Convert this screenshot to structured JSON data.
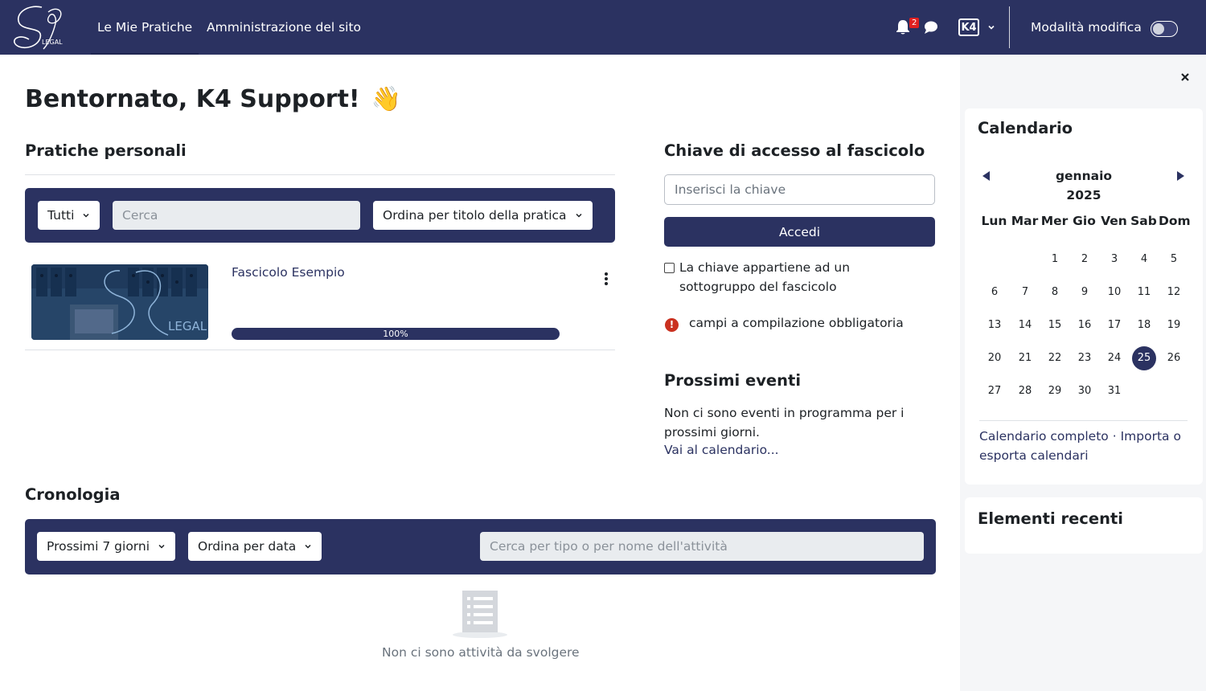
{
  "navbar": {
    "logo_text": "LEGAL",
    "links": [
      "Le Mie Pratiche",
      "Amministrazione del sito"
    ],
    "notification_count": "2",
    "user_initials": "K4",
    "edit_mode_label": "Modalità modifica",
    "bg_color": "#2b3261"
  },
  "main": {
    "greeting": "Bentornato, K4 Support!",
    "greeting_emoji": "👋",
    "personal": {
      "title": "Pratiche personali",
      "filter_label": "Tutti",
      "search_placeholder": "Cerca",
      "sort_label": "Ordina per titolo della pratica",
      "course": {
        "title": "Fascicolo Esempio",
        "image_text": "LEGAL",
        "progress_label": "100%",
        "progress_fraction": 1.0
      }
    },
    "access_key": {
      "title": "Chiave di accesso al fascicolo",
      "placeholder": "Inserisci la chiave",
      "button": "Accedi",
      "checkbox_label": "La chiave appartiene ad un sottogruppo del fascicolo",
      "required_note": "campi a compilazione obbligatoria"
    },
    "events": {
      "title": "Prossimi eventi",
      "empty_text": "Non ci sono eventi in programma per i prossimi giorni.",
      "link": "Vai al calendario..."
    },
    "timeline": {
      "title": "Cronologia",
      "range_label": "Prossimi 7 giorni",
      "sort_label": "Ordina per data",
      "search_placeholder": "Cerca per tipo o per nome dell'attività",
      "empty_text": "Non ci sono attività da svolgere"
    }
  },
  "drawer": {
    "calendar": {
      "title": "Calendario",
      "month": "gennaio",
      "year": "2025",
      "weekdays": [
        "Lun",
        "Mar",
        "Mer",
        "Gio",
        "Ven",
        "Sab",
        "Dom"
      ],
      "days": [
        "1",
        "2",
        "3",
        "4",
        "5",
        "6",
        "7",
        "8",
        "9",
        "10",
        "11",
        "12",
        "13",
        "14",
        "15",
        "16",
        "17",
        "18",
        "19",
        "20",
        "21",
        "22",
        "23",
        "24",
        "25",
        "26",
        "27",
        "28",
        "29",
        "30",
        "31"
      ],
      "today": "25",
      "full_link": "Calendario completo",
      "separator": "·",
      "import_link": "Importa o esporta calendari"
    },
    "recent": {
      "title": "Elementi recenti"
    }
  }
}
